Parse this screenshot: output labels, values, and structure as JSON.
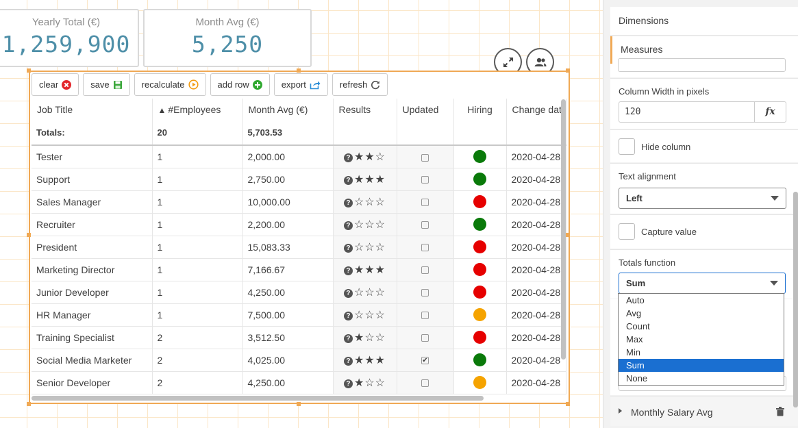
{
  "kpis": [
    {
      "title": "Yearly Total (€)",
      "value": "1,259,900"
    },
    {
      "title": "Month Avg (€)",
      "value": "5,250"
    }
  ],
  "icons": {
    "expand": "expand-arrows-icon",
    "users": "users-icon"
  },
  "toolbar": {
    "clear": "clear",
    "save": "save",
    "recalculate": "recalculate",
    "add_row": "add row",
    "export": "export",
    "refresh": "refresh"
  },
  "table": {
    "headers": [
      "Job Title",
      "#Employees",
      "Month Avg (€)",
      "Results",
      "Updated",
      "Hiring",
      "Change dat"
    ],
    "sort_indicator": "▲",
    "totals": {
      "label": "Totals:",
      "employees": "20",
      "month_avg": "5,703.53"
    },
    "rows": [
      {
        "title": "Tester",
        "employees": "1",
        "avg": "2,000.00",
        "stars": "★★☆",
        "updated": false,
        "hiring": "#0a7a0a",
        "date": "2020-04-28"
      },
      {
        "title": "Support",
        "employees": "1",
        "avg": "2,750.00",
        "stars": "★★★",
        "updated": false,
        "hiring": "#0a7a0a",
        "date": "2020-04-28"
      },
      {
        "title": "Sales Manager",
        "employees": "1",
        "avg": "10,000.00",
        "stars": "☆☆☆",
        "updated": false,
        "hiring": "#e60000",
        "date": "2020-04-28"
      },
      {
        "title": "Recruiter",
        "employees": "1",
        "avg": "2,200.00",
        "stars": "☆☆☆",
        "updated": false,
        "hiring": "#0a7a0a",
        "date": "2020-04-28"
      },
      {
        "title": "President",
        "employees": "1",
        "avg": "15,083.33",
        "stars": "☆☆☆",
        "updated": false,
        "hiring": "#e60000",
        "date": "2020-04-28"
      },
      {
        "title": "Marketing Director",
        "employees": "1",
        "avg": "7,166.67",
        "stars": "★★★",
        "updated": false,
        "hiring": "#e60000",
        "date": "2020-04-28"
      },
      {
        "title": "Junior Developer",
        "employees": "1",
        "avg": "4,250.00",
        "stars": "☆☆☆",
        "updated": false,
        "hiring": "#e60000",
        "date": "2020-04-28"
      },
      {
        "title": "HR Manager",
        "employees": "1",
        "avg": "7,500.00",
        "stars": "☆☆☆",
        "updated": false,
        "hiring": "#f5a300",
        "date": "2020-04-28"
      },
      {
        "title": "Training Specialist",
        "employees": "2",
        "avg": "3,512.50",
        "stars": "★☆☆",
        "updated": false,
        "hiring": "#e60000",
        "date": "2020-04-28"
      },
      {
        "title": "Social Media Marketer",
        "employees": "2",
        "avg": "4,025.00",
        "stars": "★★★",
        "updated": true,
        "hiring": "#0a7a0a",
        "date": "2020-04-28"
      },
      {
        "title": "Senior Developer",
        "employees": "2",
        "avg": "4,250.00",
        "stars": "★☆☆",
        "updated": false,
        "hiring": "#f5a300",
        "date": "2020-04-28"
      }
    ]
  },
  "panel": {
    "dimensions": "Dimensions",
    "measures": "Measures",
    "column_width_label": "Column Width in pixels",
    "column_width_value": "120",
    "fx": "fx",
    "hide_column": "Hide column",
    "text_alignment_label": "Text alignment",
    "text_alignment_value": "Left",
    "capture_value": "Capture value",
    "totals_function_label": "Totals function",
    "totals_function_value": "Sum",
    "totals_options": [
      "Auto",
      "Avg",
      "Count",
      "Max",
      "Min",
      "Sum",
      "None"
    ],
    "selected_option": "Sum",
    "measure_item": "Monthly Salary Avg"
  }
}
